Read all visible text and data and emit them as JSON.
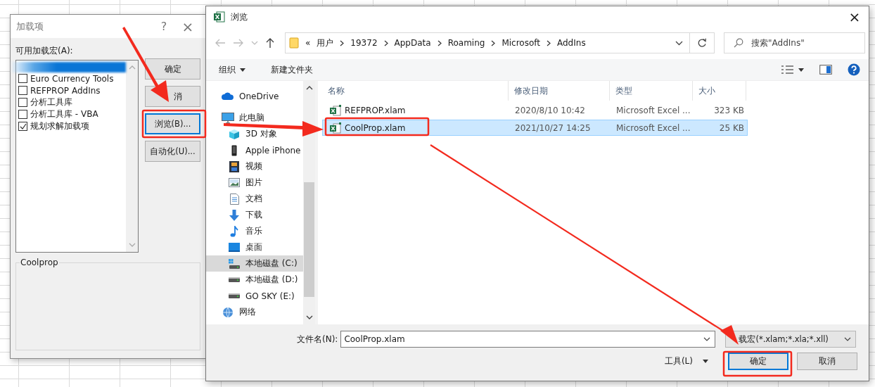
{
  "addins_dialog": {
    "title": "加载项",
    "help": "?",
    "close": "×",
    "list_label": "可用加载宏(A):",
    "addins": [
      {
        "kind": "blurred",
        "selected": true
      },
      {
        "kind": "checkbox",
        "name": "Euro Currency Tools",
        "checked": false,
        "selected": false
      },
      {
        "kind": "checkbox",
        "name": "REFPROP AddIns",
        "checked": false,
        "selected": false
      },
      {
        "kind": "checkbox",
        "name": "分析工具库",
        "checked": false,
        "selected": false
      },
      {
        "kind": "checkbox",
        "name": "分析工具库 - VBA",
        "checked": false,
        "selected": false
      },
      {
        "kind": "checkbox",
        "name": "规划求解加载项",
        "checked": true,
        "selected": false
      }
    ],
    "buttons": [
      {
        "label": "确定",
        "focused": false
      },
      {
        "label": "消",
        "focused": false
      },
      {
        "label": "浏览(B)...",
        "focused": true
      },
      {
        "label": "自动化(U)...",
        "focused": false
      }
    ],
    "group_title": "Coolprop"
  },
  "browse_dialog": {
    "title": "浏览",
    "close": "×",
    "breadcrumb_prefix": "«",
    "path": [
      "用户",
      "19372",
      "AppData",
      "Roaming",
      "Microsoft",
      "AddIns"
    ],
    "search": {
      "placeholder": "搜索\"AddIns\""
    },
    "organize": "组织",
    "new_folder": "新建文件夹",
    "nav": [
      {
        "label": "OneDrive",
        "kind": "cloud",
        "selected": false
      },
      {
        "label": "此电脑",
        "kind": "pc",
        "selected": false,
        "children": [
          {
            "label": "3D 对象",
            "kind": "cube",
            "selected": false
          },
          {
            "label": "Apple iPhone",
            "kind": "phone",
            "selected": false
          },
          {
            "label": "视频",
            "kind": "film",
            "selected": false
          },
          {
            "label": "图片",
            "kind": "image",
            "selected": false
          },
          {
            "label": "文档",
            "kind": "doc",
            "selected": false
          },
          {
            "label": "下载",
            "kind": "download",
            "selected": false
          },
          {
            "label": "音乐",
            "kind": "music",
            "selected": false
          },
          {
            "label": "桌面",
            "kind": "desktop",
            "selected": false
          },
          {
            "label": "本地磁盘 (C:)",
            "kind": "system-drive",
            "selected": true
          },
          {
            "label": "本地磁盘 (D:)",
            "kind": "drive",
            "selected": false
          },
          {
            "label": "GO SKY (E:)",
            "kind": "drive",
            "selected": false
          }
        ]
      },
      {
        "label": "网络",
        "kind": "network",
        "selected": false
      }
    ],
    "columns": [
      "名称",
      "修改日期",
      "类型",
      "大小"
    ],
    "files": [
      {
        "name": "REFPROP.xlam",
        "modified": "2020/8/10 10:42",
        "type": "Microsoft Excel ...",
        "size": "323 KB",
        "selected": false
      },
      {
        "name": "CoolProp.xlam",
        "modified": "2021/10/27 14:25",
        "type": "Microsoft Excel ...",
        "size": "25 KB",
        "selected": true
      }
    ],
    "file_name_label": "文件名(N):",
    "file_name": "CoolProp.xlam",
    "filter": "载宏(*.xlam;*.xla;*.xll)",
    "tools": "工具(L)",
    "ok": "确定",
    "cancel": "取消"
  }
}
